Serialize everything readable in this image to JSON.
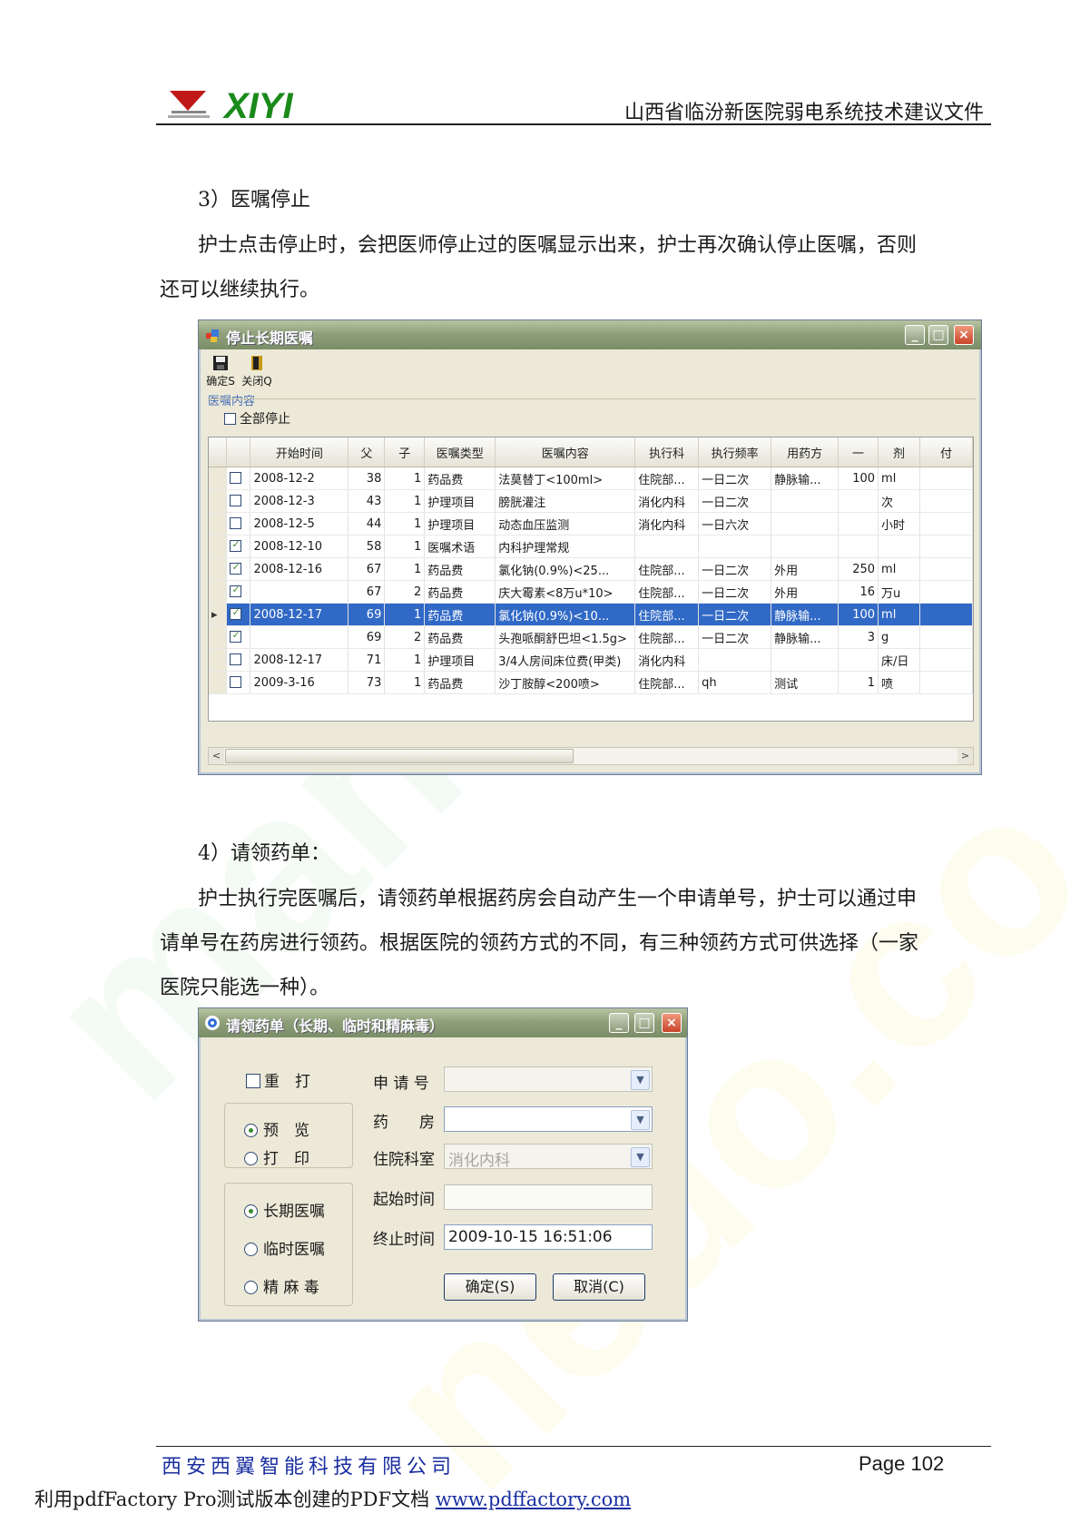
{
  "header": {
    "logo_text": "XIYI",
    "doc_title": "山西省临汾新医院弱电系统技术建议文件"
  },
  "section3": {
    "heading": "3）医嘱停止",
    "para_line1": "护士点击停止时，会把医师停止过的医嘱显示出来，护士再次确认停止医嘱，否则",
    "para_line2": "还可以继续执行。"
  },
  "window1": {
    "title": "停止长期医嘱",
    "toolbar": {
      "confirm_label": "确定S",
      "close_label": "关闭Q"
    },
    "section_label": "医嘱内容",
    "all_stop_label": "全部停止",
    "columns": [
      "",
      "",
      "开始时间",
      "父",
      "子",
      "医嘱类型",
      "医嘱内容",
      "执行科",
      "执行频率",
      "用药方",
      "一",
      "剂",
      "付"
    ],
    "rows": [
      {
        "checked": false,
        "start": "2008-12-2",
        "parent": "38",
        "child": "1",
        "type": "药品费",
        "content": "法莫替丁<100ml>",
        "dept": "住院部...",
        "freq": "一日二次",
        "route": "静脉输...",
        "dose": "100",
        "unit": "ml"
      },
      {
        "checked": false,
        "start": "2008-12-3",
        "parent": "43",
        "child": "1",
        "type": "护理项目",
        "content": "膀胱灌注",
        "dept": "消化内科",
        "freq": "一日二次",
        "route": "",
        "dose": "",
        "unit": "次"
      },
      {
        "checked": false,
        "start": "2008-12-5",
        "parent": "44",
        "child": "1",
        "type": "护理项目",
        "content": "动态血压监测",
        "dept": "消化内科",
        "freq": "一日六次",
        "route": "",
        "dose": "",
        "unit": "小时"
      },
      {
        "checked": true,
        "start": "2008-12-10",
        "parent": "58",
        "child": "1",
        "type": "医嘱术语",
        "content": "内科护理常规",
        "dept": "",
        "freq": "",
        "route": "",
        "dose": "",
        "unit": ""
      },
      {
        "checked": true,
        "start": "2008-12-16",
        "parent": "67",
        "child": "1",
        "type": "药品费",
        "content": "氯化钠(0.9%)<25...",
        "dept": "住院部...",
        "freq": "一日二次",
        "route": "外用",
        "dose": "250",
        "unit": "ml"
      },
      {
        "checked": true,
        "start": "",
        "parent": "67",
        "child": "2",
        "type": "药品费",
        "content": "庆大霉素<8万u*10>",
        "dept": "住院部...",
        "freq": "一日二次",
        "route": "外用",
        "dose": "16",
        "unit": "万u"
      },
      {
        "checked": true,
        "start": "2008-12-17",
        "parent": "69",
        "child": "1",
        "type": "药品费",
        "content": "氯化钠(0.9%)<10...",
        "dept": "住院部...",
        "freq": "一日二次",
        "route": "静脉输...",
        "dose": "100",
        "unit": "ml",
        "selected": true
      },
      {
        "checked": true,
        "start": "",
        "parent": "69",
        "child": "2",
        "type": "药品费",
        "content": "头孢哌酮舒巴坦<1.5g>",
        "dept": "住院部...",
        "freq": "一日二次",
        "route": "静脉输...",
        "dose": "3",
        "unit": "g"
      },
      {
        "checked": false,
        "start": "2008-12-17",
        "parent": "71",
        "child": "1",
        "type": "护理项目",
        "content": "3/4人房间床位费(甲类)",
        "dept": "消化内科",
        "freq": "",
        "route": "",
        "dose": "",
        "unit": "床/日"
      },
      {
        "checked": false,
        "start": "2009-3-16",
        "parent": "73",
        "child": "1",
        "type": "药品费",
        "content": "沙丁胺醇<200喷>",
        "dept": "住院部...",
        "freq": "qh",
        "route": "测试",
        "dose": "1",
        "unit": "喷"
      }
    ]
  },
  "section4": {
    "heading": "4）请领药单：",
    "para_line1": "护士执行完医嘱后，请领药单根据药房会自动产生一个申请单号，护士可以通过申",
    "para_line2": "请单号在药房进行领药。根据医院的领药方式的不同，有三种领药方式可供选择（一家",
    "para_line3": "医院只能选一种）。"
  },
  "window2": {
    "title": "请领药单（长期、临时和精麻毒）",
    "reprint_label": "重　打",
    "preview_label": "预　览",
    "print_label": "打　印",
    "long_term_label": "长期医嘱",
    "temporary_label": "临时医嘱",
    "narcotic_label": "精 麻 毒",
    "apply_no_label": "申 请 号",
    "pharmacy_label": "药　　房",
    "ward_dept_label": "住院科室",
    "ward_dept_value": "消化内科",
    "start_time_label": "起始时间",
    "start_time_value": "",
    "end_time_label": "终止时间",
    "end_time_value": "2009-10-15 16:51:06",
    "ok_label": "确定(S)",
    "cancel_label": "取消(C)"
  },
  "footer": {
    "company": "西安西翼智能科技有限公司",
    "page": "Page 102",
    "note_prefix": "利用pdfFactory Pro测试版本创建的PDF文档 ",
    "note_link": "www.pdffactory.com"
  },
  "colors": {
    "logo_green": "#1a8a1a",
    "logo_red": "#c01818",
    "selection_blue": "#3169c6",
    "footer_blue": "#1a2fa0"
  }
}
